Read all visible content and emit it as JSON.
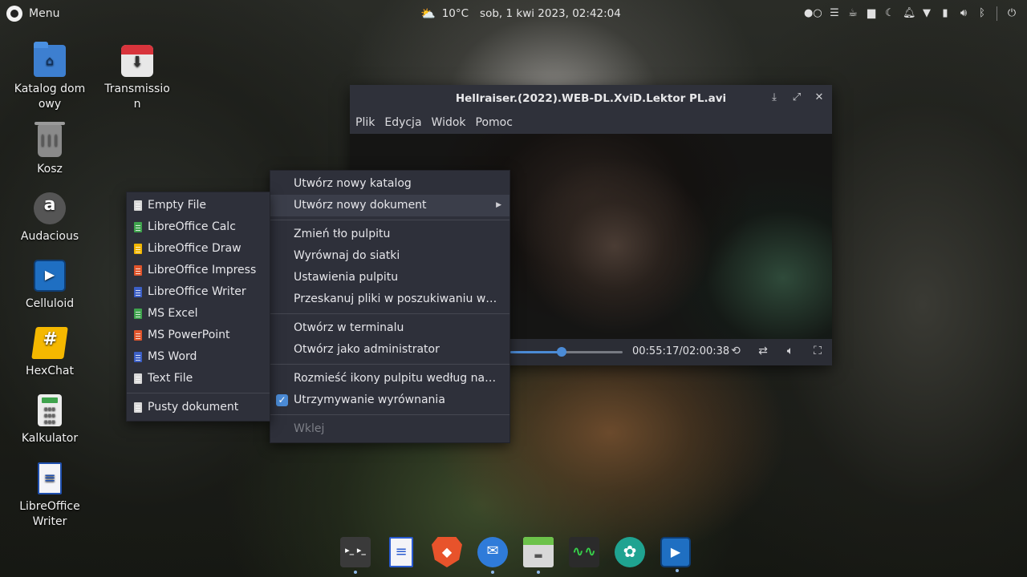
{
  "topbar": {
    "menu_label": "Menu",
    "weather_temp": "10°C",
    "datetime": "sob, 1 kwi 2023, 02:42:04",
    "tray_icons": [
      "workspace-dots-icon",
      "list-icon",
      "cup-icon",
      "folder-icon",
      "night-mode-icon",
      "bell-icon",
      "wifi-icon",
      "battery-icon",
      "volume-icon",
      "bluetooth-icon",
      "power-icon"
    ]
  },
  "desktop": {
    "icons": [
      {
        "name": "desk-icon-home",
        "label": "Katalog domowy"
      },
      {
        "name": "desk-icon-transmission",
        "label": "Transmission"
      },
      {
        "name": "desk-icon-trash",
        "label": "Kosz"
      },
      {
        "name": "desk-icon-audacious",
        "label": "Audacious"
      },
      {
        "name": "desk-icon-celluloid",
        "label": "Celluloid"
      },
      {
        "name": "desk-icon-hexchat",
        "label": "HexChat"
      },
      {
        "name": "desk-icon-calculator",
        "label": "Kalkulator"
      },
      {
        "name": "desk-icon-writer",
        "label": "LibreOffice Writer"
      }
    ]
  },
  "player": {
    "title": "Hellraiser.(2022).WEB-DL.XviD.Lektor PL.avi",
    "menu": [
      "Plik",
      "Edycja",
      "Widok",
      "Pomoc"
    ],
    "time_current": "00:55:17",
    "time_total": "02:00:38",
    "timecode": "00:55:17/02:00:38",
    "progress": 0.4582
  },
  "context_menu": {
    "items": [
      "Utwórz nowy katalog",
      "Utwórz nowy dokument",
      "Zmień tło pulpitu",
      "Wyrównaj do siatki",
      "Ustawienia pulpitu",
      "Przeskanuj pliki w poszukiwaniu wirusów",
      "Otwórz w terminalu",
      "Otwórz jako administrator",
      "Rozmieść ikony pulpitu według nazw plików",
      "Utrzymywanie wyrównania",
      "Wklej"
    ],
    "checked_item": "Utrzymywanie wyrównania",
    "disabled_item": "Wklej",
    "highlighted_item": "Utwórz nowy dokument"
  },
  "submenu": {
    "items": [
      {
        "label": "Empty File",
        "color": "#d9d9d9"
      },
      {
        "label": "LibreOffice Calc",
        "color": "#3fa34d"
      },
      {
        "label": "LibreOffice Draw",
        "color": "#f2b600"
      },
      {
        "label": "LibreOffice Impress",
        "color": "#e0542b"
      },
      {
        "label": "LibreOffice Writer",
        "color": "#3c5fc6"
      },
      {
        "label": "MS Excel",
        "color": "#3fa34d"
      },
      {
        "label": "MS PowerPoint",
        "color": "#e0542b"
      },
      {
        "label": "MS Word",
        "color": "#3c5fc6"
      },
      {
        "label": "Text File",
        "color": "#d9d9d9"
      },
      {
        "label": "Pusty dokument",
        "color": "#d9d9d9"
      }
    ]
  },
  "dock": {
    "apps": [
      "terminal-icon",
      "libreoffice-writer-icon",
      "brave-browser-icon",
      "thunderbird-icon",
      "file-manager-icon",
      "system-monitor-icon",
      "shutter-icon",
      "celluloid-icon"
    ]
  }
}
